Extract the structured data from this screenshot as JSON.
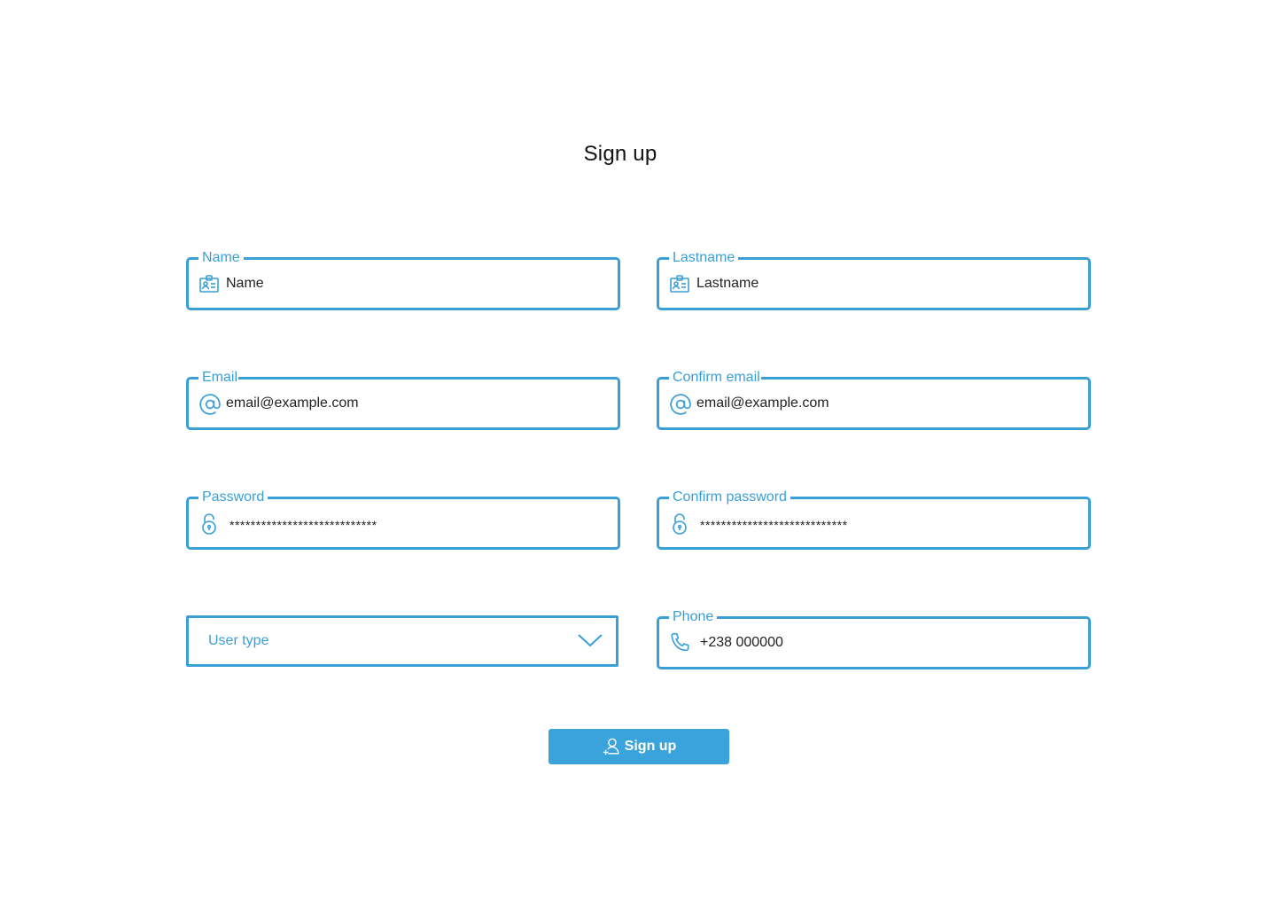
{
  "page": {
    "title": "Sign up"
  },
  "form": {
    "name": {
      "label": "Name",
      "value": "Name",
      "icon": "id-card-icon"
    },
    "lastname": {
      "label": "Lastname",
      "value": "Lastname",
      "icon": "id-card-icon"
    },
    "email": {
      "label": "Email",
      "value": "email@example.com",
      "icon": "at-sign-icon"
    },
    "confirm_email": {
      "label": "Confirm email",
      "value": "email@example.com",
      "icon": "at-sign-icon"
    },
    "password": {
      "label": "Password",
      "value": "****************************",
      "icon": "lock-icon"
    },
    "confirm_password": {
      "label": "Confirm password",
      "value": "****************************",
      "icon": "lock-icon"
    },
    "user_type": {
      "placeholder": "User type",
      "icon": "chevron-down-icon"
    },
    "phone": {
      "label": "Phone",
      "value": "+238 000000",
      "icon": "phone-icon"
    }
  },
  "submit": {
    "label": "Sign up",
    "icon": "add-user-icon"
  },
  "colors": {
    "accent": "#3a9fd6",
    "button": "#3ba3dc",
    "text": "#222222"
  }
}
